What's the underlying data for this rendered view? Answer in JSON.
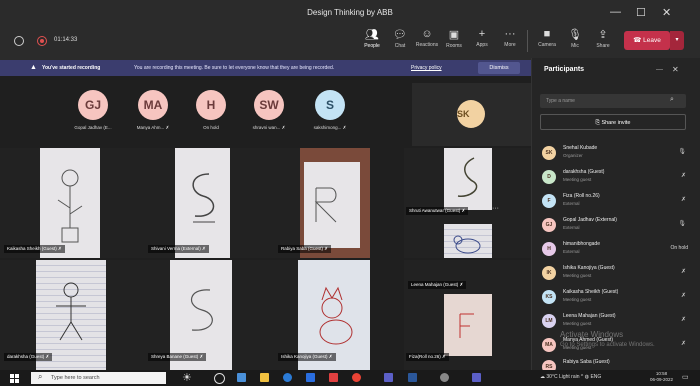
{
  "window": {
    "title": "Design Thinking by ABB",
    "minimize": "—",
    "maximize": "☐",
    "close": "✕"
  },
  "meeting": {
    "timer": "01:14:33"
  },
  "toolbar": {
    "items": [
      {
        "icon": "people-icon",
        "label": "People"
      },
      {
        "icon": "chat-icon",
        "label": "Chat"
      },
      {
        "icon": "reactions-icon",
        "label": "Reactions"
      },
      {
        "icon": "rooms-icon",
        "label": "Rooms"
      },
      {
        "icon": "apps-icon",
        "label": "Apps"
      },
      {
        "icon": "more-icon",
        "label": "More"
      }
    ],
    "camera": "Camera",
    "mic": "Mic",
    "share": "Share",
    "leave": "Leave"
  },
  "banner": {
    "title": "You've started recording",
    "text": "You are recording this meeting. Be sure to let everyone know that they are being recorded.",
    "policy_link": "Privacy policy",
    "dismiss": "Dismiss"
  },
  "gallery_avatars": [
    {
      "initials": "GJ",
      "name": "Gopal Jadhav (E...",
      "color": "#f6c5c0"
    },
    {
      "initials": "MA",
      "name": "Manya Ahm...",
      "color": "#f6c5c0"
    },
    {
      "initials": "H",
      "name": "On hold",
      "color": "#f6c5c0"
    },
    {
      "initials": "SW",
      "name": "shravni wan...",
      "color": "#f6c5c0"
    },
    {
      "initials": "S",
      "name": "sakshimong...",
      "color": "#c3e3f5"
    }
  ],
  "spotlight_avatar": {
    "initials": "SK"
  },
  "video_tiles": [
    {
      "name": "Kaikasha Sheikh (Guest)"
    },
    {
      "name": "Shivani Verma (External)"
    },
    {
      "name": "Rabiya Saba (Guest)"
    },
    {
      "name": "Shruti Awanutwar (Guest)"
    },
    {
      "name": "darakhsha (Guest)"
    },
    {
      "name": "Shreya Banane (Guest)"
    },
    {
      "name": "Ishika Kanojiya (Guest)"
    },
    {
      "name": "Leena Mahajan (Guest)"
    },
    {
      "name": "Fiza(Roll no.26)"
    }
  ],
  "panel": {
    "title": "Participants",
    "search_placeholder": "Type a name",
    "share_invite": "Share invite",
    "participants": [
      {
        "initials": "SK",
        "name": "Snehal Kubade",
        "role": "Organizer",
        "color": "#f2d2a2",
        "status": ""
      },
      {
        "initials": "D",
        "name": "darakhsha (Guest)",
        "role": "Meeting guest",
        "color": "#c8e6c9",
        "status": ""
      },
      {
        "initials": "F",
        "name": "Fiza (Roll no.26)",
        "role": "External",
        "color": "#c3e3f5",
        "status": ""
      },
      {
        "initials": "GJ",
        "name": "Gopal Jadhav (External)",
        "role": "External",
        "color": "#f6c5c0",
        "status": ""
      },
      {
        "initials": "H",
        "name": "himanibhongade",
        "role": "External",
        "color": "#e6c9e8",
        "status": "On hold"
      },
      {
        "initials": "IK",
        "name": "Ishika Kanojiya (Guest)",
        "role": "Meeting guest",
        "color": "#f2d2a2",
        "status": ""
      },
      {
        "initials": "KS",
        "name": "Kaikasha Sheikh (Guest)",
        "role": "Meeting guest",
        "color": "#c3e3f5",
        "status": ""
      },
      {
        "initials": "LM",
        "name": "Leena Mahajan (Guest)",
        "role": "Meeting guest",
        "color": "#d9d2f0",
        "status": ""
      },
      {
        "initials": "MA",
        "name": "Manya Ahmed (Guest)",
        "role": "Meeting guest",
        "color": "#f6c5c0",
        "status": ""
      },
      {
        "initials": "RS",
        "name": "Rabiya Saba (Guest)",
        "role": "",
        "color": "#f6c5c0",
        "status": ""
      }
    ]
  },
  "watermark": {
    "line1": "Activate Windows",
    "line2": "Go to Settings to activate Windows."
  },
  "taskbar": {
    "search_placeholder": "Type here to search",
    "weather": "30°C Light rain",
    "lang": "ENG",
    "time": "10:58",
    "date": "06-09-2022"
  }
}
